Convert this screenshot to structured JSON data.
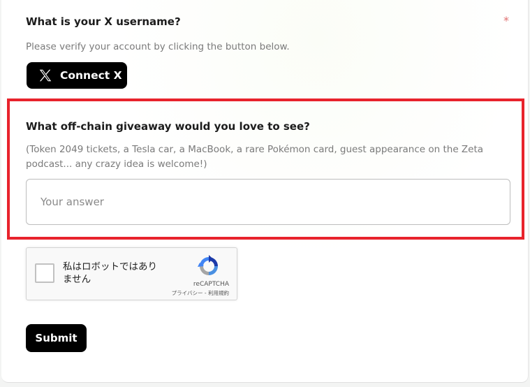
{
  "q1": {
    "title": "What is your X username?",
    "required_mark": "*",
    "description": "Please verify your account by clicking the button below.",
    "connect_label": "Connect X"
  },
  "q2": {
    "title": "What off-chain giveaway would you love to see?",
    "description_line1": "(Token 2049 tickets, a Tesla car, a MacBook, a rare Pokémon card, guest appearance on the Zeta",
    "description_line2": "podcast... any crazy idea is welcome!)",
    "placeholder": "Your answer",
    "value": ""
  },
  "recaptcha": {
    "label_line1": "私はロボットではあり",
    "label_line2": "ません",
    "brand": "reCAPTCHA",
    "links": "プライバシー - 利用規約",
    "checked": false
  },
  "submit_label": "Submit",
  "colors": {
    "highlight_border": "#e8232c",
    "required": "#e07070",
    "button_bg": "#000000"
  }
}
